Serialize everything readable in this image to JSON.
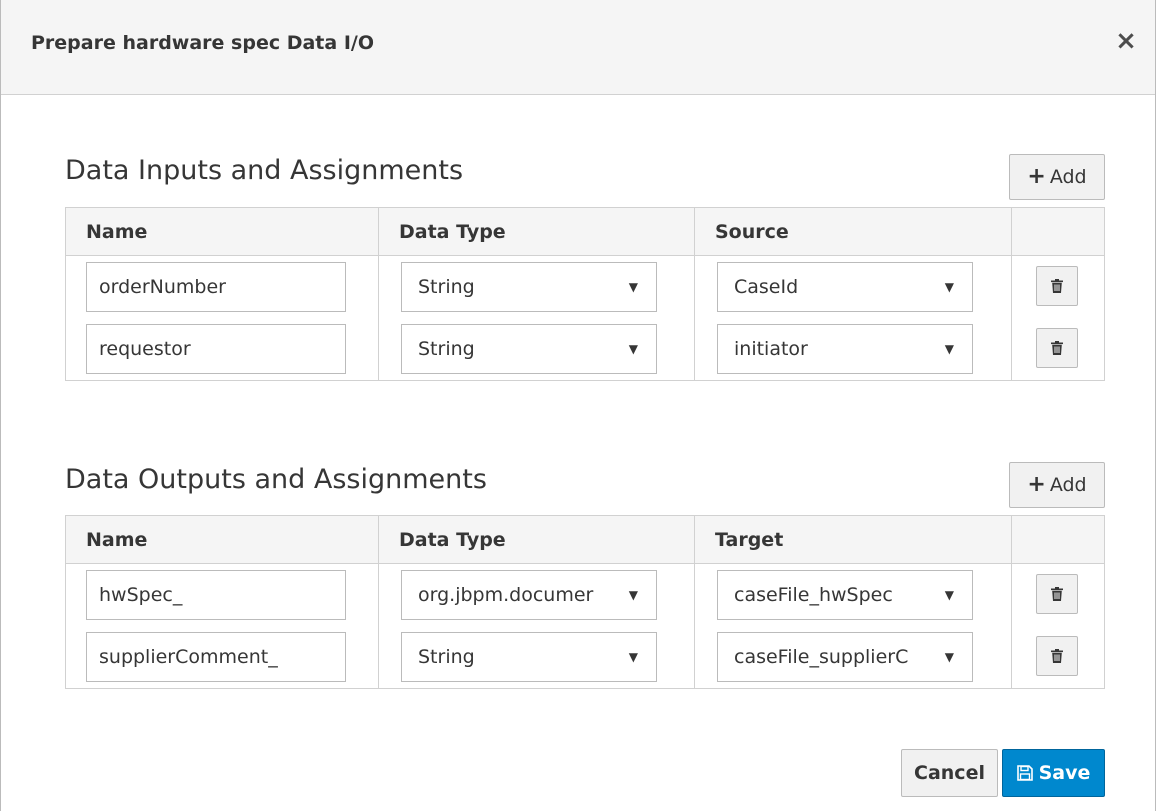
{
  "dialog": {
    "title": "Prepare hardware spec Data I/O",
    "close_glyph": "×"
  },
  "inputs": {
    "title": "Data Inputs and Assignments",
    "add_label": "Add",
    "headers": {
      "name": "Name",
      "data_type": "Data Type",
      "source": "Source"
    },
    "rows": [
      {
        "name": "orderNumber",
        "data_type": "String",
        "source": "CaseId"
      },
      {
        "name": "requestor",
        "data_type": "String",
        "source": "initiator"
      }
    ]
  },
  "outputs": {
    "title": "Data Outputs and Assignments",
    "add_label": "Add",
    "headers": {
      "name": "Name",
      "data_type": "Data Type",
      "target": "Target"
    },
    "rows": [
      {
        "name": "hwSpec_",
        "data_type": "org.jbpm.documer",
        "target": "caseFile_hwSpec"
      },
      {
        "name": "supplierComment_",
        "data_type": "String",
        "target": "caseFile_supplierC"
      }
    ]
  },
  "footer": {
    "cancel_label": "Cancel",
    "save_label": "Save"
  },
  "icons": {
    "close": "close-icon",
    "add": "plus-icon",
    "delete": "trash-icon",
    "save": "floppy-disk-icon",
    "dropdown": "caret-down-icon"
  },
  "colors": {
    "primary": "#0088ce",
    "header_bg": "#f5f5f5",
    "border": "#d1d1d1"
  }
}
